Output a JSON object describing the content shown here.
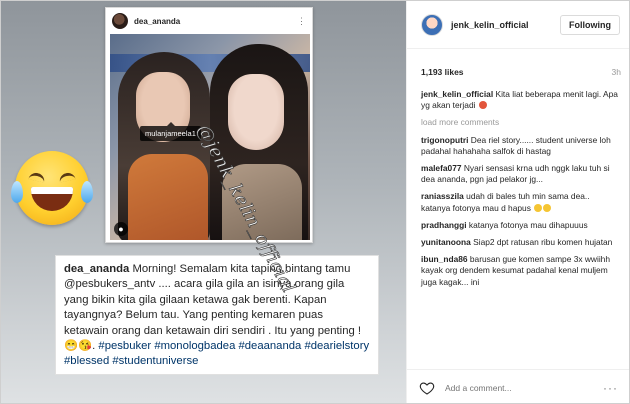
{
  "card": {
    "username": "dea_ananda",
    "more_glyph": "⋮",
    "tag_label": "mulanjameela1"
  },
  "watermark": "@jenk_kelin_official",
  "caption": {
    "username": "dea_ananda",
    "text": " Morning! Semalam kita taping bintang tamu @pesbukers_antv .... acara gila gila an isinya orang gila yang bikin kita gila gilaan ketawa gak berenti. Kapan tayangnya? Belum tau. Yang penting kemaren puas ketawain orang dan ketawain diri sendiri . Itu yang penting ! 😁😘. ",
    "hashtags": "#pesbuker #monologbadea #deaananda #dearielstory #blessed #studentuniverse"
  },
  "post": {
    "username": "jenk_kelin_official",
    "follow_label": "Following",
    "likes": "1,193 likes",
    "time": "3h",
    "load_more": "load more comments",
    "add_comment_placeholder": "Add a comment...",
    "more_glyph": "···"
  },
  "comments": [
    {
      "user": "jenk_kelin_official",
      "text": " Kita liat beberapa menit lagi. Apa yg akan terjadi "
    },
    {
      "user": "trigonoputri",
      "text": " Dea riel story...... student universe loh padahal hahahaha salfok di hastag"
    },
    {
      "user": "malefa077",
      "text": " Nyari sensasi krna udh nggk laku tuh si dea ananda, pgn jad pelakor jg..."
    },
    {
      "user": "raniasszila",
      "text": " udah di bales tuh min sama dea.. katanya fotonya mau d hapus "
    },
    {
      "user": "pradhanggi",
      "text": " katanya fotonya mau dihapuuus"
    },
    {
      "user": "yunitanoona",
      "text": " Siap2 dpt ratusan ribu komen hujatan"
    },
    {
      "user": "ibun_nda86",
      "text": " barusan gue komen sampe 3x wwiihh kayak org dendem kesumat padahal kenal muljem juga kagak... ini"
    }
  ],
  "icons": {
    "heart": "heart-icon",
    "more": "more-icon",
    "laugh": "laughing-tears-emoji"
  }
}
